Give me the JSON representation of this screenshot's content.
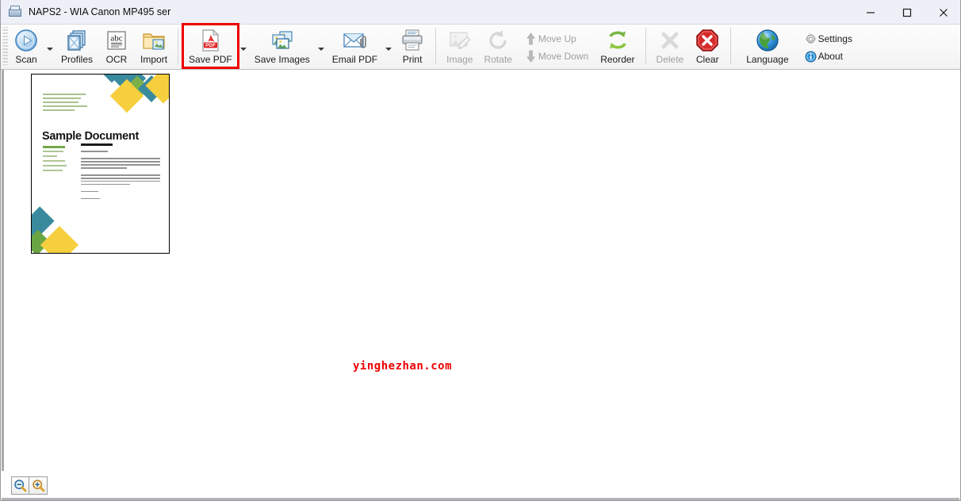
{
  "window": {
    "title": "NAPS2 - WIA Canon MP495 ser",
    "app_icon": "scanner-icon",
    "controls": {
      "minimize": "minimize-icon",
      "maximize": "maximize-icon",
      "close": "close-icon"
    }
  },
  "toolbar": {
    "items": [
      {
        "id": "scan",
        "label": "Scan",
        "icon": "scan-play-icon",
        "dropdown": true,
        "disabled": false
      },
      {
        "id": "profiles",
        "label": "Profiles",
        "icon": "profiles-icon",
        "dropdown": false,
        "disabled": false
      },
      {
        "id": "ocr",
        "label": "OCR",
        "icon": "ocr-abc-icon",
        "dropdown": false,
        "disabled": false
      },
      {
        "id": "import",
        "label": "Import",
        "icon": "import-folder-icon",
        "dropdown": false,
        "disabled": false
      },
      {
        "id": "save-pdf",
        "label": "Save PDF",
        "icon": "pdf-file-icon",
        "dropdown": true,
        "disabled": false,
        "highlighted": true
      },
      {
        "id": "save-images",
        "label": "Save Images",
        "icon": "images-icon",
        "dropdown": true,
        "disabled": false
      },
      {
        "id": "email-pdf",
        "label": "Email PDF",
        "icon": "email-envelope-icon",
        "dropdown": true,
        "disabled": false
      },
      {
        "id": "print",
        "label": "Print",
        "icon": "printer-icon",
        "dropdown": false,
        "disabled": false
      },
      {
        "id": "image",
        "label": "Image",
        "icon": "image-edit-icon",
        "dropdown": false,
        "disabled": true
      },
      {
        "id": "rotate",
        "label": "Rotate",
        "icon": "rotate-cw-icon",
        "dropdown": false,
        "disabled": true
      },
      {
        "id": "reorder",
        "label": "Reorder",
        "icon": "reorder-arrows-icon",
        "dropdown": false,
        "disabled": false
      },
      {
        "id": "delete",
        "label": "Delete",
        "icon": "delete-x-icon",
        "dropdown": false,
        "disabled": true
      },
      {
        "id": "clear",
        "label": "Clear",
        "icon": "clear-octagon-icon",
        "dropdown": false,
        "disabled": false
      },
      {
        "id": "language",
        "label": "Language",
        "icon": "globe-icon",
        "dropdown": false,
        "disabled": false
      }
    ],
    "move_up": {
      "label": "Move Up",
      "icon": "arrow-up-icon",
      "disabled": true
    },
    "move_down": {
      "label": "Move Down",
      "icon": "arrow-down-icon",
      "disabled": true
    },
    "settings": {
      "label": "Settings",
      "icon": "gear-icon"
    },
    "about": {
      "label": "About",
      "icon": "info-icon"
    }
  },
  "content": {
    "thumbnail": {
      "title": "Sample Document",
      "selected": true
    },
    "watermark": "yinghezhan.com"
  },
  "statusbar": {
    "zoom_out": {
      "label": "Zoom Out",
      "icon": "magnifier-minus-icon"
    },
    "zoom_in": {
      "label": "Zoom In",
      "icon": "magnifier-plus-icon"
    }
  },
  "colors": {
    "highlight": "#ee0000",
    "titlebar_bg": "#eef0f8",
    "toolbar_bg": "#f6f6f6",
    "watermark": "#ee0000"
  }
}
